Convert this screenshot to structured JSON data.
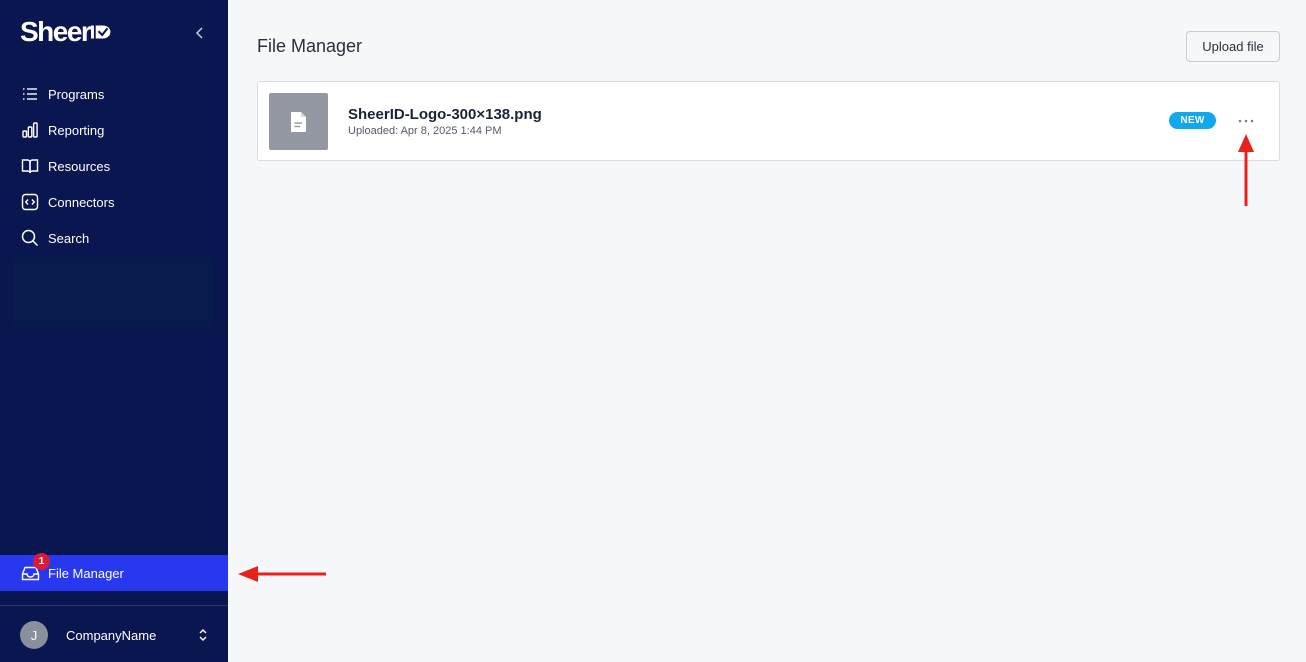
{
  "sidebar": {
    "logo_text": "Sheer",
    "nav": [
      {
        "label": "Programs",
        "icon": "list-icon"
      },
      {
        "label": "Reporting",
        "icon": "bar-chart-icon"
      },
      {
        "label": "Resources",
        "icon": "book-icon"
      },
      {
        "label": "Connectors",
        "icon": "code-icon"
      },
      {
        "label": "Search",
        "icon": "search-icon"
      }
    ],
    "file_manager": {
      "label": "File Manager",
      "badge": "1",
      "icon": "inbox-icon"
    },
    "account": {
      "avatar_initial": "J",
      "company": "CompanyName"
    }
  },
  "main": {
    "title": "File Manager",
    "upload_label": "Upload file",
    "files": [
      {
        "name": "SheerID-Logo-300×138.png",
        "uploaded": "Uploaded: Apr 8, 2025 1:44 PM",
        "badge": "NEW",
        "icon": "document-icon"
      }
    ]
  },
  "colors": {
    "sidebar_bg": "#0a1650",
    "active_item": "#2838ef",
    "badge_new": "#11a8ec",
    "notification": "#d81b3b",
    "annotation_arrow": "#e8211b"
  }
}
